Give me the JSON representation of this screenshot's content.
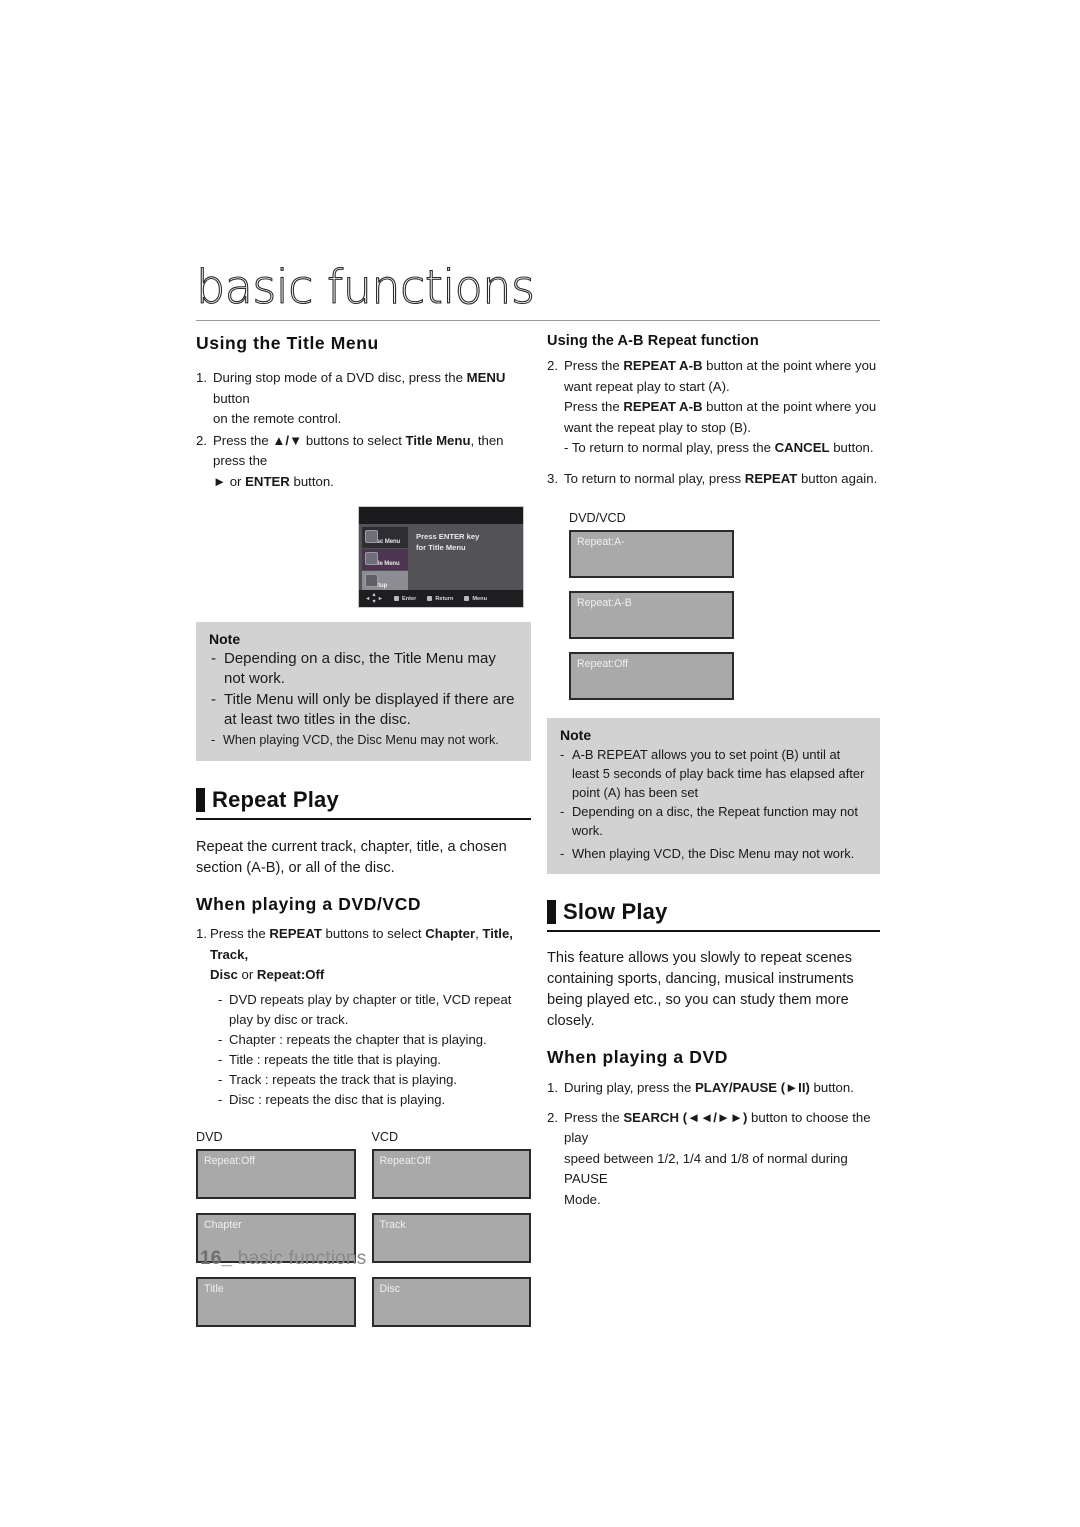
{
  "header": {
    "chapter_title": "basic functions"
  },
  "footer": {
    "page_number": "16_",
    "chapter_label": "basic functions"
  },
  "left_column": {
    "title_menu": {
      "heading": "Using the Title Menu",
      "steps": [
        {
          "num": "1.",
          "text_before": "During stop mode of a DVD disc, press the ",
          "bold": "MENU",
          "text_after": " button",
          "cont": "on the remote control."
        },
        {
          "num": "2.",
          "text_before": "Press the ",
          "bold": "▲/▼",
          "text_mid": " buttons to select ",
          "bold2": "Title Menu",
          "text_after": ", then press the",
          "cont_symbol": "►",
          "cont_before": " or ",
          "cont_bold": "ENTER",
          "cont_after": " button."
        }
      ],
      "osd": {
        "message_line1": "Press ENTER key",
        "message_line2": "for Title Menu",
        "tabs": [
          {
            "label": "Disc Menu",
            "selected": false
          },
          {
            "label": "Title Menu",
            "selected": true
          },
          {
            "label": "Setup",
            "selected": false
          }
        ],
        "bottom_bar": [
          "Enter",
          "Return",
          "Menu"
        ]
      },
      "note": {
        "title": "Note",
        "items": [
          {
            "text": "Depending on a disc, the Title Menu may not work.",
            "emphasis": "big"
          },
          {
            "text": "Title Menu will only be displayed if there are at least two titles in the disc.",
            "emphasis": "big"
          },
          {
            "text": "When playing VCD, the Disc Menu may not work.",
            "emphasis": "small"
          }
        ]
      }
    },
    "repeat_play": {
      "section_title": "Repeat Play",
      "intro": "Repeat the current track, chapter, title, a chosen section (A-B), or all of the disc.",
      "sub_heading": "When playing a DVD/VCD",
      "step": {
        "num": "1.",
        "text_before": "Press the ",
        "bold1": "REPEAT",
        "text_mid": " buttons to select ",
        "bold2": "Chapter",
        "text_mid2": ", ",
        "bold3": "Title, Track,",
        "cont_bold1": "Disc",
        "cont_mid": " or ",
        "cont_bold2": "Repeat:Off"
      },
      "details": [
        "DVD repeats play by chapter or title, VCD repeat play by disc or track.",
        "Chapter : repeats the chapter that is playing.",
        "Title : repeats the title that is playing.",
        "Track : repeats the track that is playing.",
        "Disc : repeats the disc that is playing."
      ],
      "osd_columns": [
        {
          "label": "DVD",
          "boxes": [
            "Repeat:Off",
            "Chapter",
            "Title"
          ]
        },
        {
          "label": "VCD",
          "boxes": [
            "Repeat:Off",
            "Track",
            "Disc"
          ]
        }
      ]
    }
  },
  "right_column": {
    "ab_repeat": {
      "heading": "Using the A-B Repeat function",
      "step2": {
        "num": "2.",
        "line1_before": "Press the ",
        "line1_bold": "REPEAT A-B",
        "line1_after": " button at the point where you",
        "line2": "want repeat play to start (A).",
        "line3_before": "Press the ",
        "line3_bold": "REPEAT A-B",
        "line3_after": " button at the point where you",
        "line4": "want the repeat play to stop (B).",
        "line5_before": "- To return to normal play, press the ",
        "line5_bold": "CANCEL",
        "line5_after": " button."
      },
      "step3": {
        "num": "3.",
        "text_before": "To return to normal play, press ",
        "bold": "REPEAT",
        "text_after": " button again."
      },
      "osd_label": "DVD/VCD",
      "osd_boxes": [
        "Repeat:A-",
        "Repeat:A-B",
        "Repeat:Off"
      ],
      "note": {
        "title": "Note",
        "items": [
          "A-B REPEAT allows you to set point (B) until at least 5 seconds of play back time has elapsed after point (A) has been set",
          "Depending on a disc, the Repeat function may not work.",
          "When playing VCD, the Disc Menu may not work."
        ]
      }
    },
    "slow_play": {
      "section_title": "Slow Play",
      "intro": "This feature allows you slowly to repeat scenes containing sports, dancing, musical instruments being played etc., so you can study them more closely.",
      "sub_heading": "When playing a DVD",
      "steps": [
        {
          "num": "1.",
          "text_before": "During play, press the ",
          "bold": "PLAY/PAUSE (►II)",
          "text_after": " button."
        },
        {
          "num": "2.",
          "text_before": "Press the ",
          "bold": "SEARCH (◄◄/►►)",
          "text_after": " button to choose the play",
          "cont1": "speed between 1/2, 1/4 and 1/8 of normal during PAUSE",
          "cont2": "Mode."
        }
      ]
    }
  }
}
